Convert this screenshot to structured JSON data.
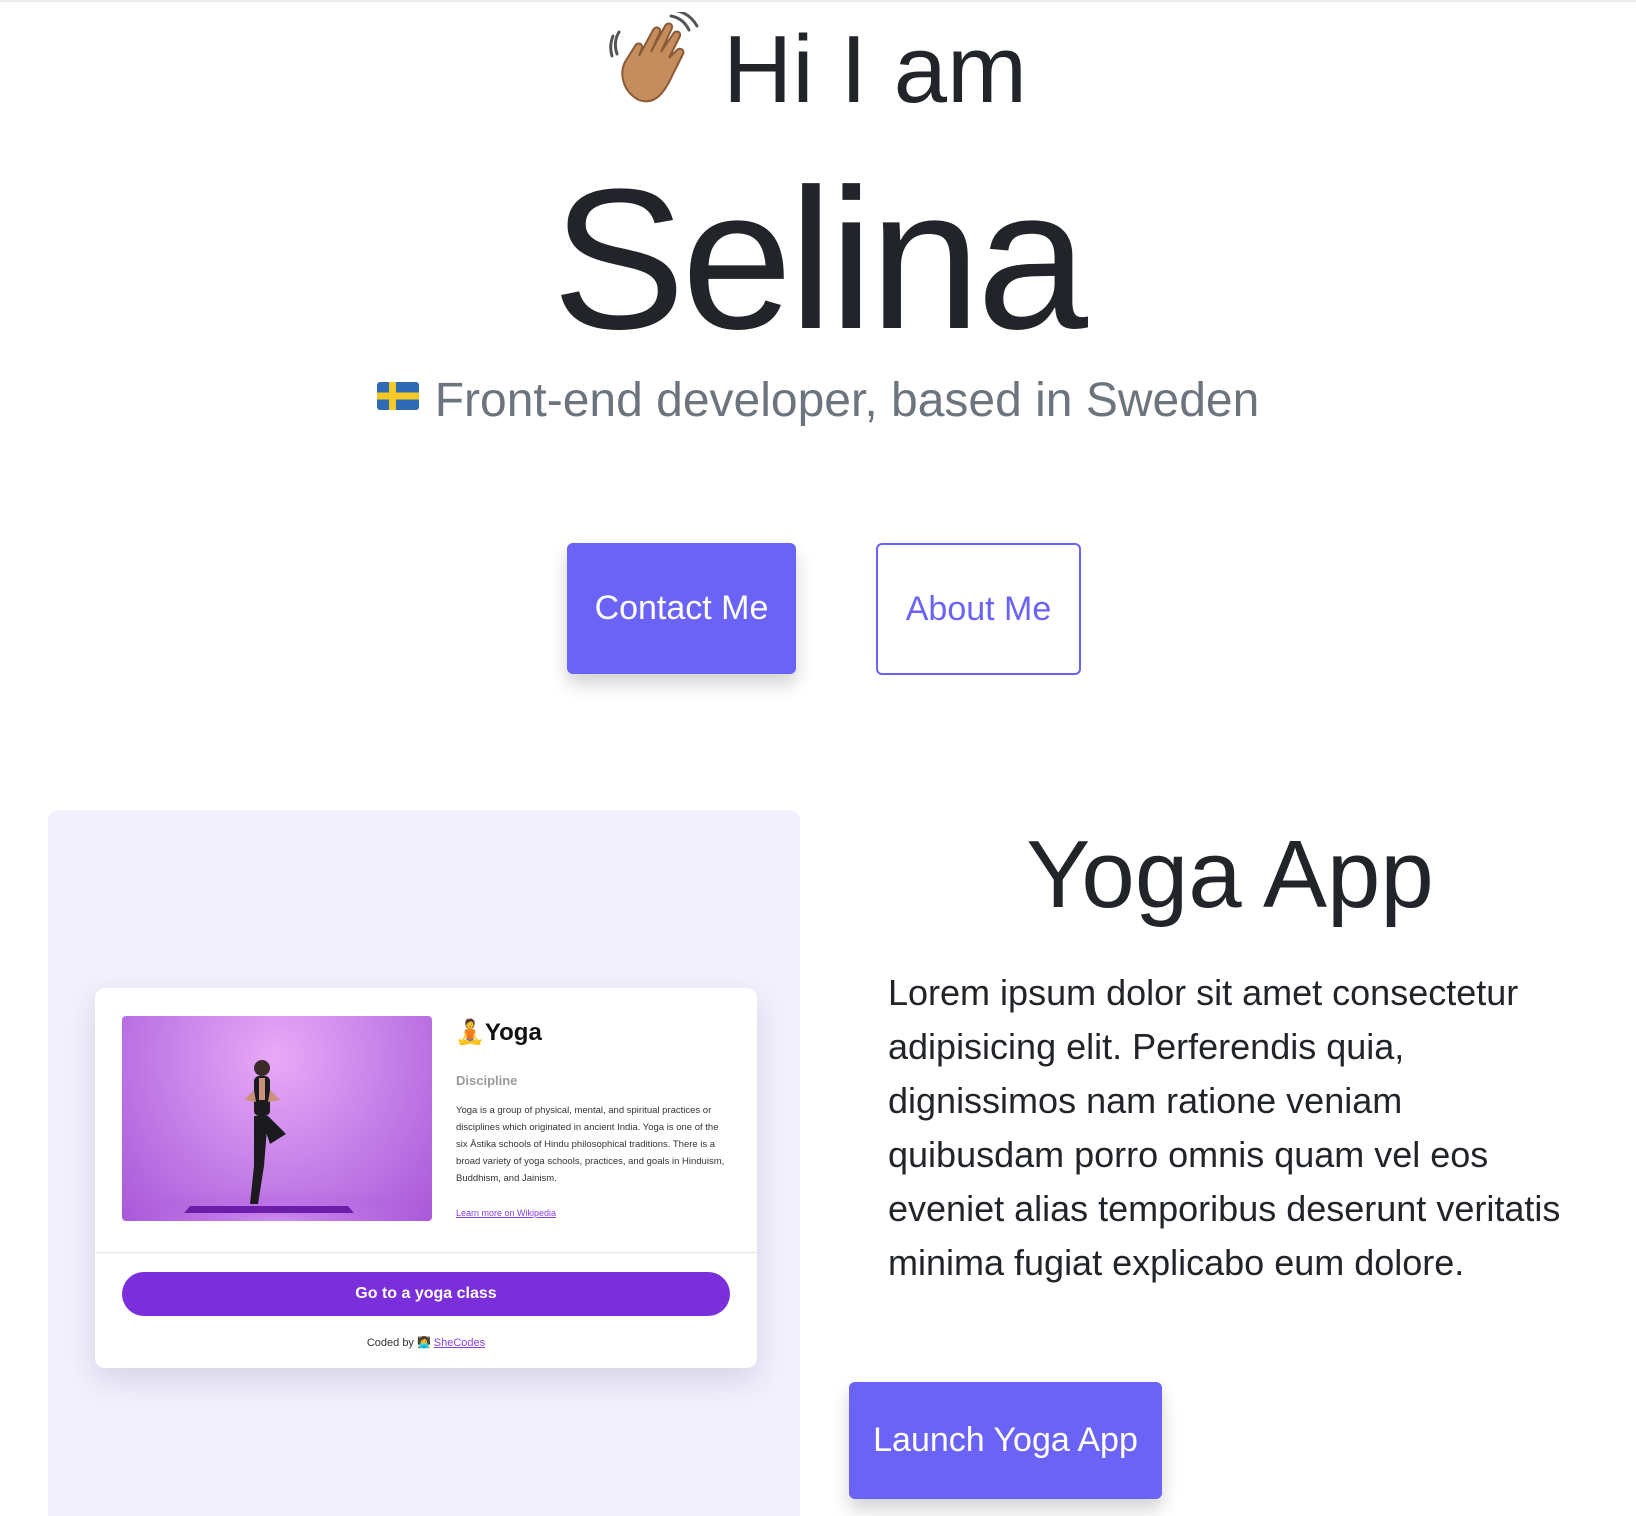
{
  "hero": {
    "greeting": "Hi I am",
    "name": "Selina",
    "tagline": "Front-end developer, based in Sweden"
  },
  "icons": {
    "wave": "waving-hand-icon",
    "flag": "sweden-flag-icon"
  },
  "buttons": {
    "contact": "Contact Me",
    "about": "About Me",
    "launch": "Launch Yoga App"
  },
  "project": {
    "title": "Yoga App",
    "description": "Lorem ipsum dolor sit amet consectetur adipisicing elit. Perferendis quia, dignissimos nam ratione veniam quibusdam porro omnis quam vel eos eveniet alias temporibus deserunt veritatis minima fugiat explicabo eum dolore.",
    "preview": {
      "title": "Yoga",
      "subtitle": "Discipline",
      "description": "Yoga is a group of physical, mental, and spiritual practices or disciplines which originated in ancient India. Yoga is one of the six Āstika schools of Hindu philosophical traditions. There is a broad variety of yoga schools, practices, and goals in Hinduism, Buddhism, and Jainism.",
      "link": "Learn more on Wikipedia",
      "button": "Go to a yoga class",
      "footer_prefix": "Coded by",
      "footer_link": "SheCodes"
    }
  },
  "colors": {
    "accent": "#6a63f6",
    "text": "#212529",
    "muted": "#6c757d",
    "panel": "#f2f0fc",
    "yoga_purple": "#7b2fdb"
  }
}
